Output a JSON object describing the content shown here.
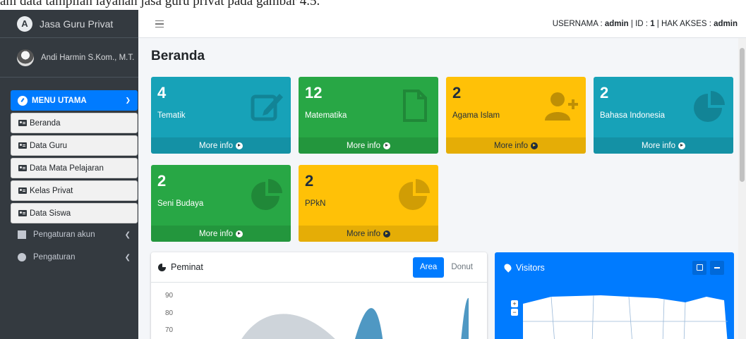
{
  "doc_strip": {
    "text": "am data tampilan layanan jasa guru privat pada gambar 4.5."
  },
  "sidebar": {
    "brand": {
      "logo_letter": "A",
      "text": "Jasa Guru Privat"
    },
    "user": {
      "name": "Andi Harmin S.Kom., M.T."
    },
    "menu_main": {
      "label": "MENU UTAMA"
    },
    "items": [
      {
        "label": "Beranda"
      },
      {
        "label": "Data Guru"
      },
      {
        "label": "Data Mata Pelajaran"
      },
      {
        "label": "Kelas Privat"
      },
      {
        "label": "Data Siswa"
      }
    ],
    "groups": [
      {
        "label": "Pengaturan akun"
      },
      {
        "label": "Pengaturan"
      }
    ]
  },
  "topbar": {
    "username_label": "USERNAMA : ",
    "username": "admin",
    "sep1": " | ID : ",
    "id": "1",
    "sep2": " | HAK AKSES : ",
    "role": "admin"
  },
  "page": {
    "title": "Beranda"
  },
  "stat_boxes": [
    {
      "value": "4",
      "label": "Tematik",
      "link": "More info",
      "color": "#17a2b8",
      "icon": "edit-icon"
    },
    {
      "value": "12",
      "label": "Matematika",
      "link": "More info",
      "color": "#28a745",
      "icon": "file-icon"
    },
    {
      "value": "2",
      "label": "Agama Islam",
      "link": "More info",
      "color": "#ffc107",
      "icon": "user-plus-icon"
    },
    {
      "value": "2",
      "label": "Bahasa Indonesia",
      "link": "More info",
      "color": "#17a2b8",
      "icon": "pie-chart-icon"
    },
    {
      "value": "2",
      "label": "Seni Budaya",
      "link": "More info",
      "color": "#28a745",
      "icon": "pie-chart-icon"
    },
    {
      "value": "2",
      "label": "PPkN",
      "link": "More info",
      "color": "#ffc107",
      "icon": "pie-chart-icon"
    }
  ],
  "peminat": {
    "title": "Peminat",
    "tabs": [
      {
        "label": "Area",
        "active": true
      },
      {
        "label": "Donut",
        "active": false
      }
    ],
    "y_ticks": [
      "90",
      "80",
      "70"
    ]
  },
  "visitors": {
    "title": "Visitors",
    "zoom_in": "+",
    "zoom_out": "−"
  },
  "colors": {
    "primary": "#007bff",
    "sidebar": "#343a40",
    "info": "#17a2b8",
    "success": "#28a745",
    "warning": "#ffc107"
  }
}
